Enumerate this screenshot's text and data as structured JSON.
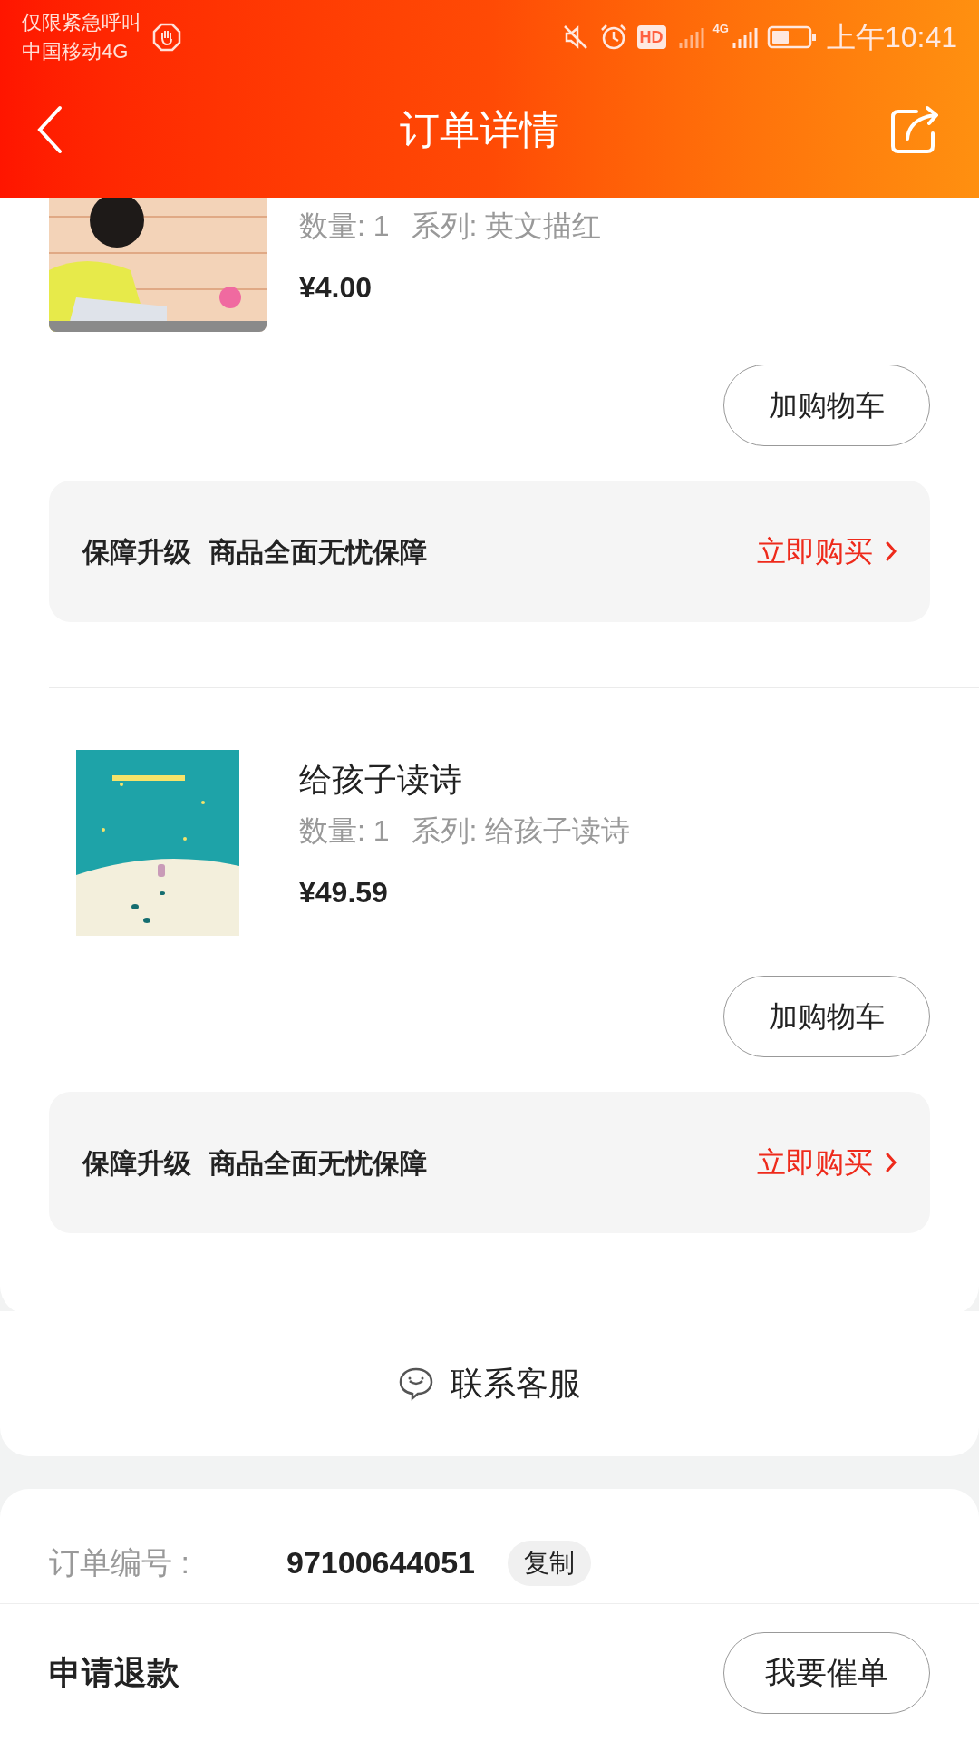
{
  "status_bar": {
    "carrier_lines": [
      "仅限紧急呼叫",
      "中国移动4G"
    ],
    "hd_badge": "HD",
    "network": "4G",
    "time": "上午10:41"
  },
  "header": {
    "title": "订单详情"
  },
  "products": [
    {
      "quantity": "数量: 1",
      "series": "系列: 英文描红",
      "price": "¥4.00",
      "add_to_cart": "加购物车",
      "guarantee": {
        "label": "保障升级",
        "text": "商品全面无忧保障",
        "action": "立即购买"
      }
    },
    {
      "title": "给孩子读诗",
      "quantity": "数量: 1",
      "series": "系列: 给孩子读诗",
      "price": "¥49.59",
      "add_to_cart": "加购物车",
      "guarantee": {
        "label": "保障升级",
        "text": "商品全面无忧保障",
        "action": "立即购买"
      }
    }
  ],
  "contact": {
    "label": "联系客服"
  },
  "order_info": {
    "label": "订单编号 :",
    "value": "97100644051",
    "copy": "复制"
  },
  "bottom_bar": {
    "refund": "申请退款",
    "urge": "我要催单"
  }
}
